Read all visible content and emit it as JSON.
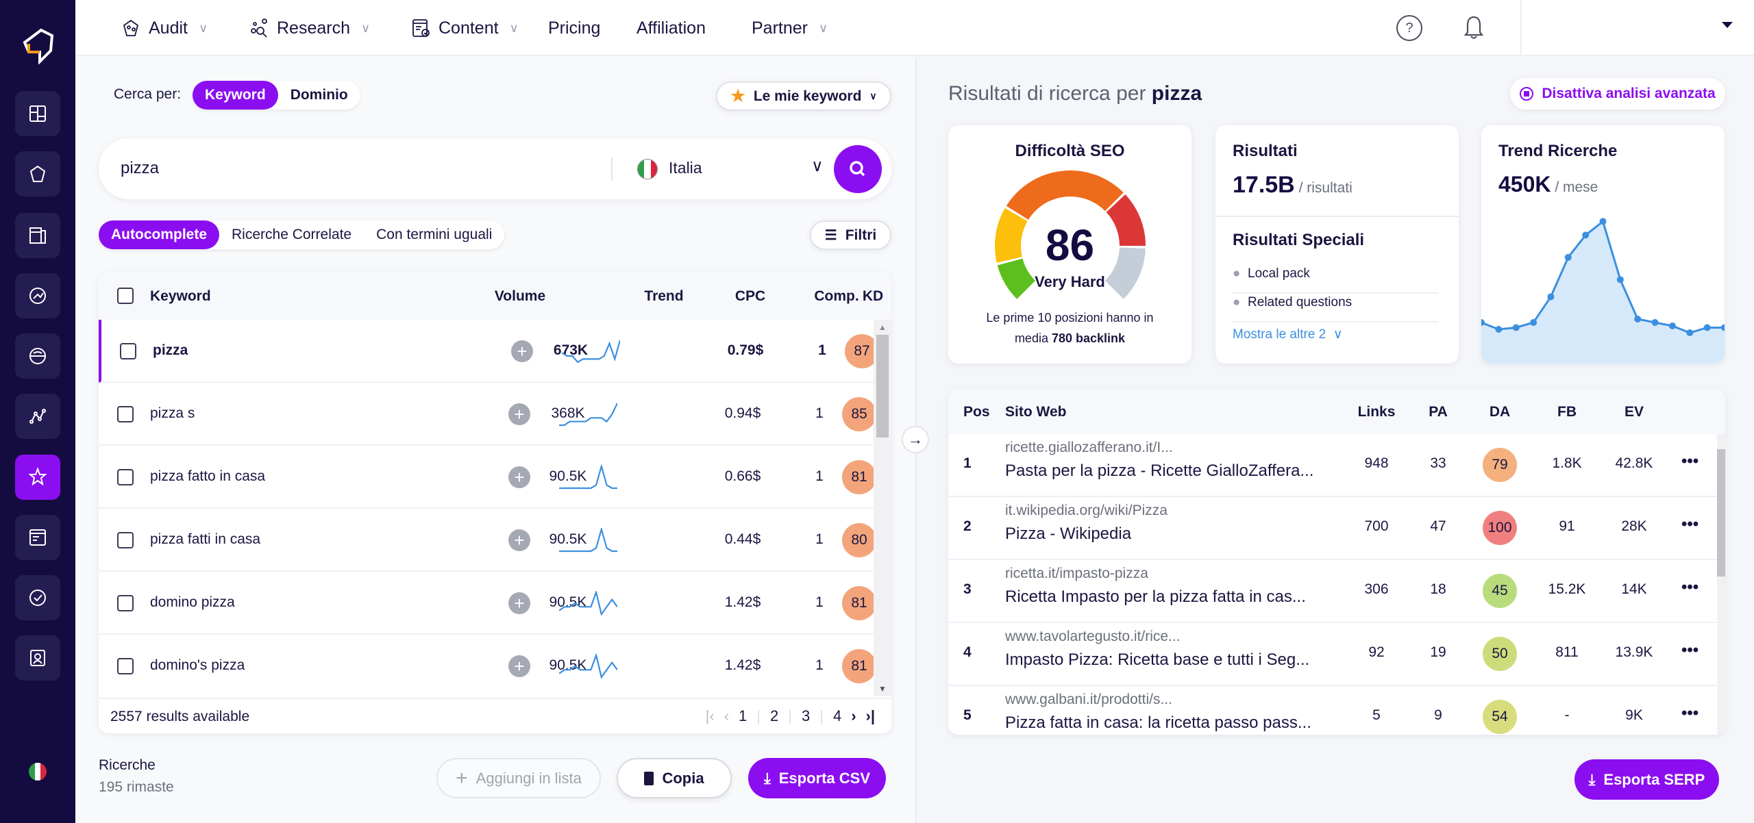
{
  "nav": {
    "items": [
      {
        "label": "Audit",
        "icon": "audit-icon",
        "dropdown": true
      },
      {
        "label": "Research",
        "icon": "research-icon",
        "dropdown": true
      },
      {
        "label": "Content",
        "icon": "content-icon",
        "dropdown": true
      },
      {
        "label": "Pricing"
      },
      {
        "label": "Affiliation"
      },
      {
        "label": "Partner",
        "dropdown": true
      }
    ],
    "help_icon": "help-circle-icon",
    "bell_icon": "bell-icon"
  },
  "sidebar": {
    "active_index": 6,
    "items": [
      "dashboard",
      "audit",
      "content",
      "research-globe",
      "rank-tracker",
      "keyword-research",
      "favorites",
      "content-editor",
      "backlinks",
      "reports"
    ],
    "language": "it"
  },
  "search": {
    "cerca_per_label": "Cerca per:",
    "mode_options": [
      "Keyword",
      "Dominio"
    ],
    "active_mode": "Keyword",
    "my_keywords_label": "Le mie keyword",
    "query": "pizza",
    "country": "Italia",
    "tabs": [
      "Autocomplete",
      "Ricerche Correlate",
      "Con termini uguali"
    ],
    "active_tab": "Autocomplete",
    "filters_label": "Filtri"
  },
  "keywords": {
    "headers": {
      "keyword": "Keyword",
      "volume": "Volume",
      "trend": "Trend",
      "cpc": "CPC",
      "comp": "Comp.",
      "kd": "KD"
    },
    "rows": [
      {
        "keyword": "pizza",
        "volume": "673K",
        "cpc": "0.79$",
        "comp": "1",
        "kd": "87",
        "trend": [
          5,
          4,
          4,
          2,
          3,
          3,
          3,
          3,
          4,
          8,
          3,
          9
        ],
        "selected": true
      },
      {
        "keyword": "pizza s",
        "volume": "368K",
        "cpc": "0.94$",
        "comp": "1",
        "kd": "85",
        "trend": [
          3,
          3,
          4,
          4,
          4,
          4,
          5,
          5,
          5,
          4,
          6,
          9
        ]
      },
      {
        "keyword": "pizza fatto in casa",
        "volume": "90.5K",
        "cpc": "0.66$",
        "comp": "1",
        "kd": "81",
        "trend": [
          2,
          2,
          2,
          2,
          2,
          2,
          2,
          3,
          9,
          3,
          2,
          2
        ]
      },
      {
        "keyword": "pizza fatti in casa",
        "volume": "90.5K",
        "cpc": "0.44$",
        "comp": "1",
        "kd": "80",
        "trend": [
          2,
          2,
          2,
          2,
          2,
          2,
          2,
          3,
          9,
          3,
          2,
          2
        ]
      },
      {
        "keyword": "domino pizza",
        "volume": "90.5K",
        "cpc": "1.42$",
        "comp": "1",
        "kd": "81",
        "trend": [
          3,
          4,
          4,
          5,
          4,
          4,
          4,
          8,
          2,
          4,
          6,
          4
        ]
      },
      {
        "keyword": "domino's pizza",
        "volume": "90.5K",
        "cpc": "1.42$",
        "comp": "1",
        "kd": "81",
        "trend": [
          3,
          4,
          4,
          5,
          4,
          4,
          4,
          8,
          2,
          4,
          6,
          4
        ]
      }
    ],
    "results_available": "2557 results available",
    "pages": [
      "1",
      "2",
      "3",
      "4"
    ],
    "current_page": "1"
  },
  "bottom": {
    "ricerche_label": "Ricerche",
    "remaining": "195 rimaste",
    "add_list": "Aggiungi in lista",
    "copy": "Copia",
    "export_csv": "Esporta CSV"
  },
  "results": {
    "title_prefix": "Risultati di ricerca per",
    "title_keyword": "pizza",
    "advanced_toggle": "Disattiva analisi avanzata",
    "seo": {
      "title": "Difficoltà SEO",
      "value": 86,
      "label": "Very Hard",
      "desc_prefix": "Le prime 10 posizioni hanno in media",
      "desc_bold": "780 backlink"
    },
    "risultati": {
      "title": "Risultati",
      "value": "17.5B",
      "unit": "/ risultati"
    },
    "speciali": {
      "title": "Risultati Speciali",
      "items": [
        "Local pack",
        "Related questions"
      ],
      "more": "Mostra le altre 2"
    },
    "trend": {
      "title": "Trend Ricerche",
      "value": "450K",
      "unit": "/ mese",
      "points": [
        20,
        16,
        17,
        20,
        35,
        58,
        71,
        79,
        45,
        22,
        20,
        18,
        14,
        17,
        17
      ],
      "color": "#3b8fe0"
    }
  },
  "serp": {
    "headers": {
      "pos": "Pos",
      "site": "Sito Web",
      "links": "Links",
      "pa": "PA",
      "da": "DA",
      "fb": "FB",
      "ev": "EV"
    },
    "rows": [
      {
        "pos": "1",
        "url": "ricette.giallozafferano.it/I...",
        "title": "Pasta per la pizza - Ricette GialloZaffera...",
        "links": "948",
        "pa": "33",
        "da": "79",
        "fb": "1.8K",
        "ev": "42.8K",
        "da_color": "#f4b07d"
      },
      {
        "pos": "2",
        "url": "it.wikipedia.org/wiki/Pizza",
        "title": "Pizza - Wikipedia",
        "links": "700",
        "pa": "47",
        "da": "100",
        "fb": "91",
        "ev": "28K",
        "da_color": "#f08080"
      },
      {
        "pos": "3",
        "url": "ricetta.it/impasto-pizza",
        "title": "Ricetta Impasto per la pizza fatta in cas...",
        "links": "306",
        "pa": "18",
        "da": "45",
        "fb": "15.2K",
        "ev": "14K",
        "da_color": "#b8dc7c"
      },
      {
        "pos": "4",
        "url": "www.tavolartegusto.it/rice...",
        "title": "Impasto Pizza: Ricetta base e tutti i Seg...",
        "links": "92",
        "pa": "19",
        "da": "50",
        "fb": "811",
        "ev": "13.9K",
        "da_color": "#cddc7b"
      },
      {
        "pos": "5",
        "url": "www.galbani.it/prodotti/s...",
        "title": "Pizza fatta in casa: la ricetta passo pass...",
        "links": "5",
        "pa": "9",
        "da": "54",
        "fb": "-",
        "ev": "9K",
        "da_color": "#d8dc7c"
      }
    ],
    "export_label": "Esporta SERP"
  },
  "colors": {
    "accent": "#8b0ef0",
    "sidebar": "#140c40",
    "kd": "#f4a47b"
  }
}
